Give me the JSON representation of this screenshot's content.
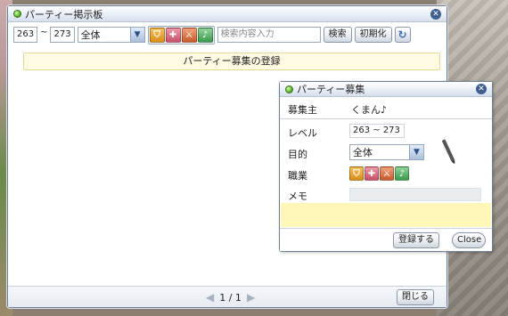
{
  "main_window": {
    "title": "パーティー掲示板",
    "level_min": "263",
    "level_max": "273",
    "tilde": "~",
    "purpose_selected": "全体",
    "search_placeholder": "検索内容入力",
    "search_button": "検索",
    "reset_button": "初期化",
    "register_bar": "パーティー募集の登録",
    "pager_text": "1 / 1",
    "close_button": "閉じる"
  },
  "popup": {
    "title": "パーティー募集",
    "recruiter_label": "募集主",
    "recruiter_name": "くまん♪",
    "level_label": "レベル",
    "level_range": "263 ~ 273",
    "purpose_label": "目的",
    "purpose_selected": "全体",
    "job_label": "職業",
    "memo_label": "メモ",
    "register_button": "登録する",
    "close_button": "Close"
  },
  "icons": {
    "window_dot": "green-orb-icon",
    "close": "close-icon",
    "dropdown": "chevron-down-icon",
    "refresh": "refresh-icon",
    "pager_prev": "chevron-left-icon",
    "pager_next": "chevron-right-icon",
    "jobs": [
      "shield-job-icon",
      "healer-job-icon",
      "attacker-job-icon",
      "support-job-icon"
    ]
  },
  "colors": {
    "accent": "#3f5f8f",
    "register_bar_bg": "#fffbe3",
    "memo_bg": "#fff6b8"
  }
}
